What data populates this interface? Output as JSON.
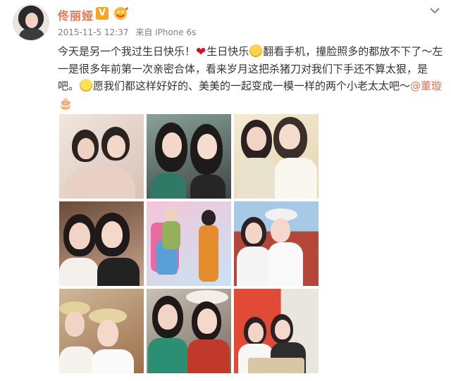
{
  "post": {
    "author": {
      "name": "佟丽娅",
      "verified_badge": "V",
      "avatar_icon": "avatar-photo",
      "vip_icon": "vip-emoji-icon"
    },
    "meta": {
      "datetime": "2015-11-5 12:37",
      "source": "来自 iPhone 6s"
    },
    "text": {
      "part1": "今天是另一个我过生日快乐！",
      "part2": "生日快乐",
      "part3": "翻看手机，撞脸照多的都放不下了～左一是很多年前第一次亲密合体，看来岁月这把杀猪刀对我们下手还不算太狠，是吧。",
      "part4": "愿我们都这样好好的、美美的一起变成一模一样的两个小老太太吧～",
      "mention": "@董璇",
      "emojis": [
        "heart",
        "kiss-face",
        "wink-face",
        "cake"
      ]
    },
    "photos": [
      {
        "id": "photo-1"
      },
      {
        "id": "photo-2"
      },
      {
        "id": "photo-3"
      },
      {
        "id": "photo-4"
      },
      {
        "id": "photo-5"
      },
      {
        "id": "photo-6"
      },
      {
        "id": "photo-7"
      },
      {
        "id": "photo-8"
      },
      {
        "id": "photo-9"
      }
    ]
  },
  "colors": {
    "accent": "#eb7350",
    "meta": "#808080",
    "text": "#333333",
    "vbadge": "#f6a623"
  }
}
